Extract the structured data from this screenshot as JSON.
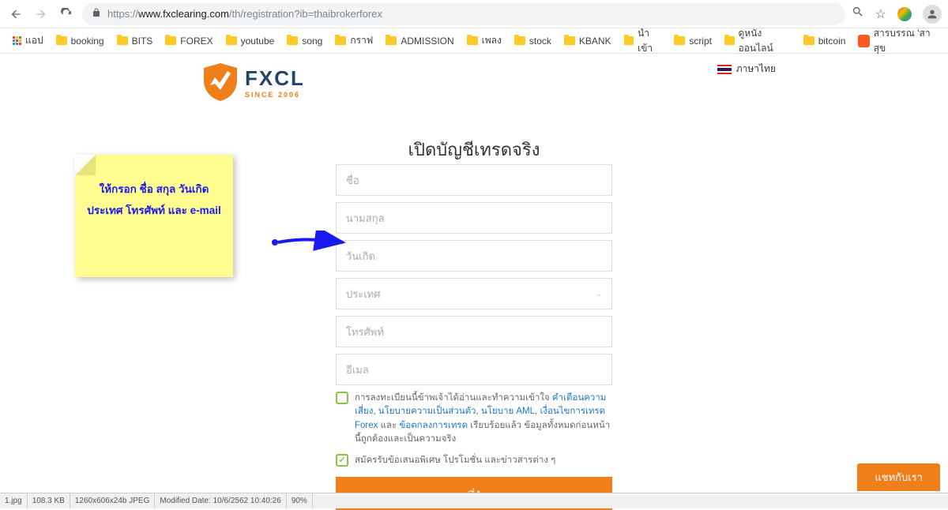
{
  "browser": {
    "url_prefix": "https://",
    "url_host": "www.fxclearing.com",
    "url_path": "/th/registration?ib=thaibrokerforex"
  },
  "bookmarks": {
    "apps": "แอป",
    "items": [
      "booking",
      "BITS",
      "FOREX",
      "youtube",
      "song",
      "กราฟ",
      "ADMISSION",
      "เพลง",
      "stock",
      "KBANK",
      "นำเข้า",
      "script",
      "ดูหนังออนไลน์",
      "bitcoin"
    ],
    "ext": "สารบรรณ 'สาสุข"
  },
  "lang": {
    "label": "ภาษาไทย"
  },
  "logo": {
    "main": "FXCL",
    "sub": "SINCE 2006"
  },
  "heading": "เปิดบัญชีเทรดจริง",
  "form": {
    "name": "ชื่อ",
    "surname": "นามสกุล",
    "birthday": "วันเกิด",
    "country": "ประเทศ",
    "phone": "โทรศัพท์",
    "email": "อีเมล",
    "consent1_prefix": "การลงทะเบียนนี้ข้าพเจ้าได้อ่านและทำความเข้าใจ ",
    "consent1_link1": "คำเตือนความเสี่ยง",
    "consent1_sep1": ", ",
    "consent1_link2": "นโยบายความเป็นส่วนตัว",
    "consent1_sep2": ", ",
    "consent1_link3": "นโยบาย AML",
    "consent1_sep3": ", ",
    "consent1_link4": "เงื่อนไขการเทรด Forex",
    "consent1_sep4": " และ ",
    "consent1_link5": "ข้อตกลงการเทรด",
    "consent1_suffix": " เรียบร้อยแล้ว ข้อมูลทั้งหมดก่อนหน้านี้ถูกต้องและเป็นความจริง",
    "consent2": "สมัครรับข้อเสนอพิเศษ โปรโมชั่น และข่าวสารต่าง ๆ",
    "submit": "ส่ง"
  },
  "note": {
    "line1": "ให้กรอก ชื่อ สกุล วันเกิด",
    "line2": "ประเทศ โทรศัพท์ และ e-mail"
  },
  "chat": "แชทกับเรา",
  "status": {
    "s1": "1.jpg",
    "s2": "108.3 KB",
    "s3": "1260x606x24b JPEG",
    "s4": "Modified Date: 10/6/2562 10:40:26",
    "s5": "90%"
  }
}
